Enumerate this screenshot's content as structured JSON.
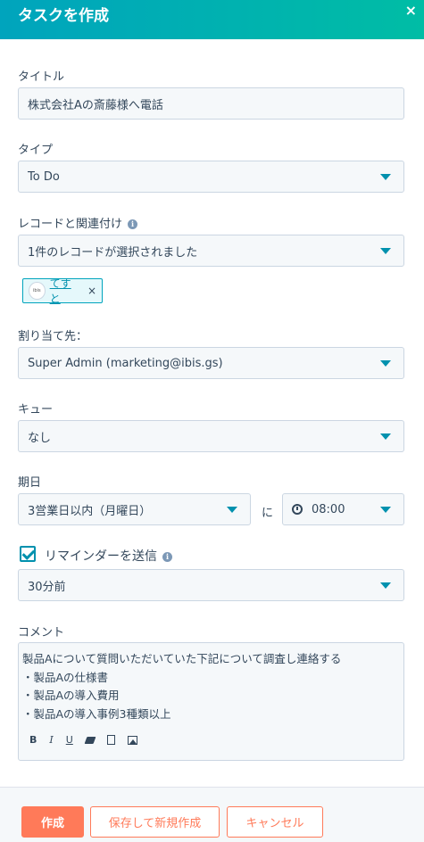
{
  "header": {
    "title": "タスクを作成",
    "close": "×"
  },
  "form": {
    "title_label": "タイトル",
    "title_value": "株式会社Aの斎藤様へ電話",
    "type_label": "タイプ",
    "type_value": "To Do",
    "record_label": "レコードと関連付け",
    "record_value": "1件のレコードが選択されました",
    "chip": {
      "avatar_text": "ibis",
      "label": "てすと",
      "remove": "×"
    },
    "assign_label": "割り当て先：",
    "assign_value": "Super Admin (marketing@ibis.gs)",
    "queue_label": "キュー",
    "queue_value": "なし",
    "due_label": "期日",
    "due_value": "3営業日以内（月曜日）",
    "due_connector": "に",
    "due_time": "08:00",
    "reminder_label": "リマインダーを送信",
    "reminder_checked": true,
    "reminder_value": "30分前",
    "comment_label": "コメント",
    "comment_lines": [
      "製品Aについて質問いただいていた下記について調査し連絡する",
      "・製品Aの仕様書",
      "・製品Aの導入費用",
      "・製品Aの導入事例3種類以上"
    ],
    "toolbar": {
      "bold": "B",
      "italic": "I",
      "underline": "U"
    }
  },
  "footer": {
    "create": "作成",
    "save_new": "保存して新規作成",
    "cancel": "キャンセル"
  },
  "colors": {
    "accent": "#0091ae",
    "primary": "#ff7a59",
    "header": "#00a4bd"
  }
}
